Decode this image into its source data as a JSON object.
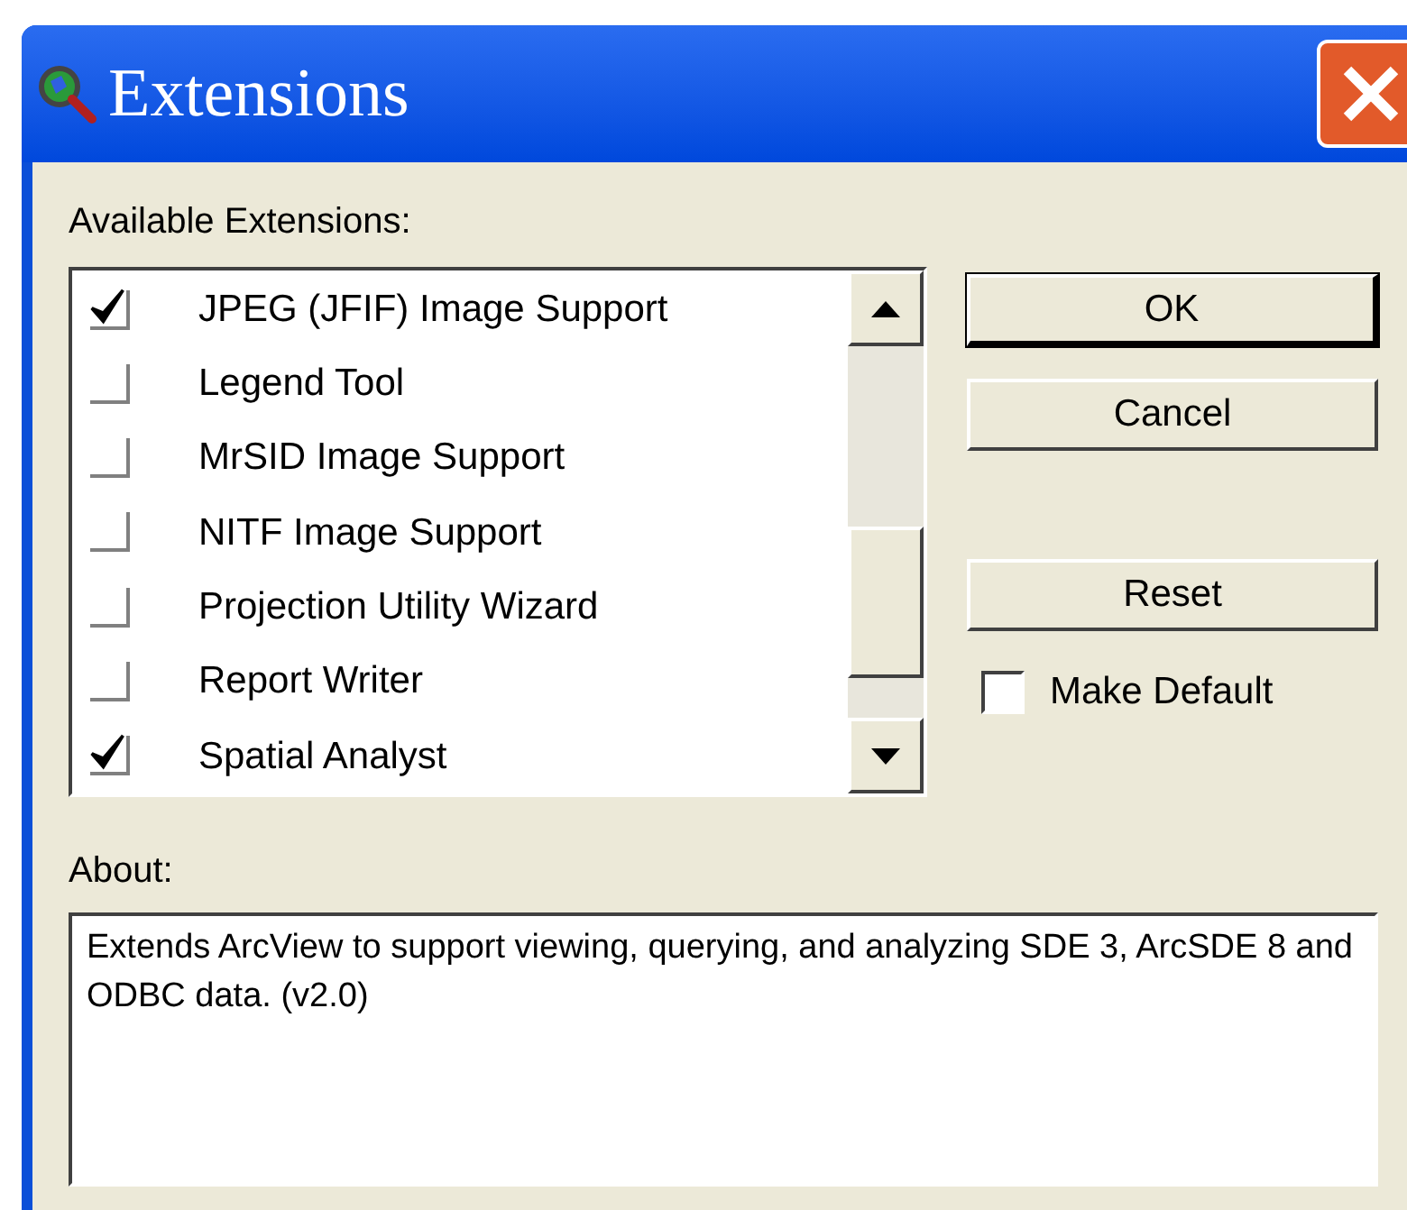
{
  "window": {
    "title": "Extensions"
  },
  "available_label": "Available Extensions:",
  "extensions": [
    {
      "name": "JPEG (JFIF) Image Support",
      "checked": true
    },
    {
      "name": "Legend Tool",
      "checked": false
    },
    {
      "name": "MrSID Image Support",
      "checked": false
    },
    {
      "name": "NITF Image Support",
      "checked": false
    },
    {
      "name": "Projection Utility Wizard",
      "checked": false
    },
    {
      "name": "Report Writer",
      "checked": false
    },
    {
      "name": "Spatial Analyst",
      "checked": true
    }
  ],
  "buttons": [
    {
      "label": "OK",
      "default": true
    },
    {
      "label": "Cancel",
      "default": false
    },
    {
      "label": "Reset",
      "default": false
    }
  ],
  "make_default": {
    "label": "Make Default",
    "checked": false
  },
  "about": {
    "label": "About:",
    "text": "Extends ArcView to support viewing, querying, and analyzing SDE 3, ArcSDE 8 and ODBC data. (v2.0)"
  }
}
